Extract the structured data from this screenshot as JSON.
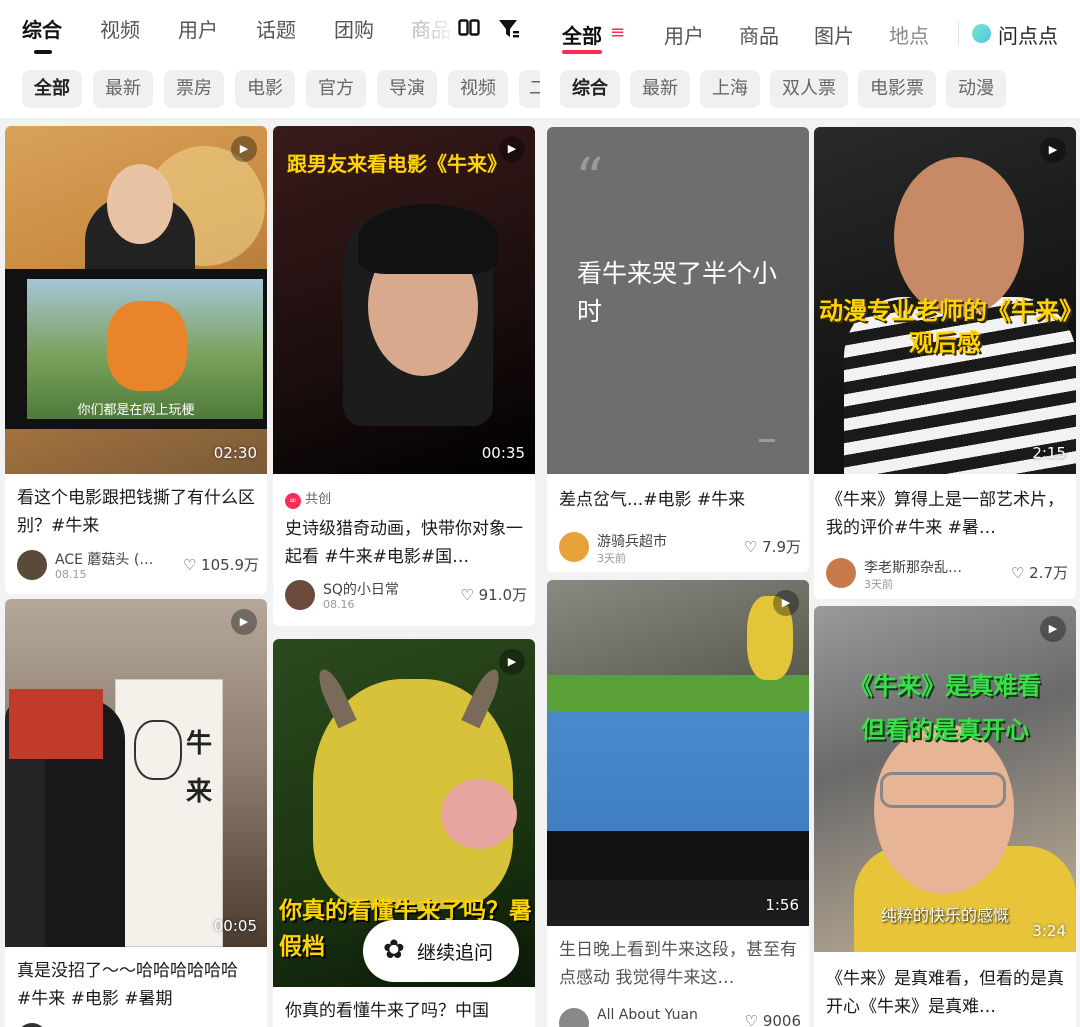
{
  "left": {
    "tabs": [
      "综合",
      "视频",
      "用户",
      "话题",
      "团购",
      "商品"
    ],
    "layout_icon": "layout-grid-icon",
    "filter_icon": "filter-icon",
    "chips": [
      "全部",
      "最新",
      "票房",
      "电影",
      "官方",
      "导演",
      "视频",
      "二"
    ],
    "cards": [
      {
        "title": "看这个电影跟把钱撕了有什么区别？#牛来",
        "author": "ACE 蘑菇头 (…",
        "date": "08.15",
        "likes": "105.9万",
        "duration": "02:30",
        "overlay": "你们都是在网上玩梗",
        "play_icon": "play-icon"
      },
      {
        "badge": "共创",
        "title": "史诗级猎奇动画，快带你对象一起看 #牛来#电影#国…",
        "author": "SQ的小日常",
        "date": "08.16",
        "likes": "91.0万",
        "duration": "00:35",
        "overlay": "跟男友来看电影《牛来》"
      },
      {
        "title": "真是没招了～～哈哈哈哈哈哈 #牛来 #电影 #暑期",
        "duration": "00:05",
        "overlay": "牛 来"
      },
      {
        "title": "你真的看懂牛来了吗？中国",
        "overlay": "你真的看懂牛来了吗？暑假档"
      }
    ],
    "floating_button": "继续追问"
  },
  "right": {
    "tabs": [
      "全部",
      "用户",
      "商品",
      "图片",
      "地点"
    ],
    "ask_label": "问点点",
    "chips": [
      "综合",
      "最新",
      "上海",
      "双人票",
      "电影票",
      "动漫"
    ],
    "cards": [
      {
        "quote_text": "看牛来哭了半个小时",
        "title": "差点岔气...#电影 #牛来",
        "author": "游骑兵超市",
        "date": "3天前",
        "likes": "7.9万"
      },
      {
        "title": "《牛来》算得上是一部艺术片，我的评价#牛来 #暑…",
        "author": "李老斯那杂乱…",
        "date": "3天前",
        "likes": "2.7万",
        "duration": "2:15",
        "overlay": "动漫专业老师的《牛来》观后感"
      },
      {
        "title": "生日晚上看到牛来这段，甚至有点感动 我觉得牛来这…",
        "author": "All About Yuan",
        "likes": "9006",
        "duration": "1:56"
      },
      {
        "title": "《牛来》是真难看，但看的是真开心《牛来》是真难…",
        "duration": "3:24",
        "overlay_line1": "《牛来》是真难看",
        "overlay_line2": "但看的是真开心",
        "overlay_bottom": "纯粹的快乐的感慨"
      }
    ]
  },
  "colors": {
    "accent_red": "#fe2c55",
    "text_dark": "#1a1a1a",
    "chip_bg": "#f0f0f0",
    "caption_yellow": "#ffd400",
    "caption_green": "#39e04a"
  }
}
